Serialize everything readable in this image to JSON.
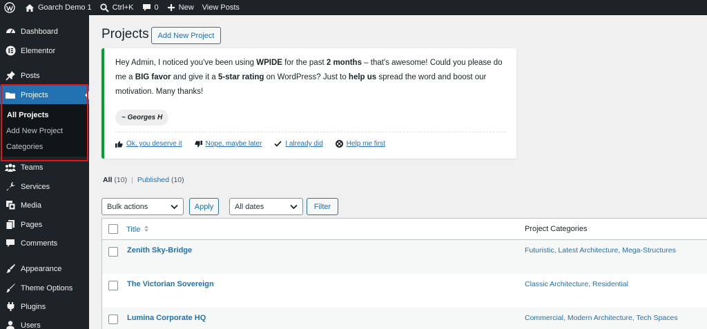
{
  "adminbar": {
    "site_name": "Goarch Demo 1",
    "search_shortcut": "Ctrl+K",
    "comments_count": "0",
    "new_label": "New",
    "view_posts_label": "View Posts"
  },
  "sidebar": {
    "items": [
      {
        "label": "Dashboard",
        "icon": "dashboard-icon"
      },
      {
        "label": "Elementor",
        "icon": "elementor-icon"
      },
      {
        "label": "Posts",
        "icon": "pin-icon"
      },
      {
        "label": "Projects",
        "icon": "folder-icon"
      },
      {
        "label": "Teams",
        "icon": "groups-icon"
      },
      {
        "label": "Services",
        "icon": "wrench-icon"
      },
      {
        "label": "Media",
        "icon": "media-icon"
      },
      {
        "label": "Pages",
        "icon": "pages-icon"
      },
      {
        "label": "Comments",
        "icon": "comment-icon"
      },
      {
        "label": "Appearance",
        "icon": "brush-icon"
      },
      {
        "label": "Theme Options",
        "icon": "paintbrush-icon"
      },
      {
        "label": "Plugins",
        "icon": "plugin-icon"
      },
      {
        "label": "Users",
        "icon": "user-icon"
      }
    ],
    "submenu": {
      "all": "All Projects",
      "add_new": "Add New Project",
      "categories": "Categories"
    }
  },
  "page": {
    "title": "Projects",
    "add_new_label": "Add New Project"
  },
  "notice": {
    "p1": "Hey Admin, I noticed you've been using ",
    "b1": "WPIDE",
    "p2": " for the past ",
    "b2": "2 months",
    "p3": " – that's awesome! Could you please do me a ",
    "b3": "BIG favor",
    "p4": " and give it a ",
    "b4": "5-star rating",
    "p5": " on WordPress? Just to ",
    "b5": "help us",
    "p6": " spread the word and boost our motivation. Many thanks!",
    "signature": "~ Georges H",
    "actions": {
      "yes": "Ok, you deserve it",
      "no": "Nope, maybe later",
      "done": "I already did",
      "help": "Help me first"
    }
  },
  "filters": {
    "all_label": "All",
    "all_count": "(10)",
    "published_label": "Published",
    "published_count": "(10)",
    "bulk_actions": "Bulk actions",
    "apply": "Apply",
    "dates": "All dates",
    "filter": "Filter"
  },
  "table": {
    "col_title": "Title",
    "col_categories": "Project Categories",
    "rows": [
      {
        "title": "Zenith Sky-Bridge",
        "categories": "Futuristic, Latest Architecture, Mega-Structures"
      },
      {
        "title": "The Victorian Sovereign",
        "categories": "Classic Architecture, Residential"
      },
      {
        "title": "Lumina Corporate HQ",
        "categories": "Commercial, Modern Architecture, Tech Spaces"
      }
    ]
  },
  "colors": {
    "admin_dark": "#1d2327",
    "accent_blue": "#2271b1",
    "highlight_red": "#e3131b",
    "notice_green": "#00a32a"
  }
}
